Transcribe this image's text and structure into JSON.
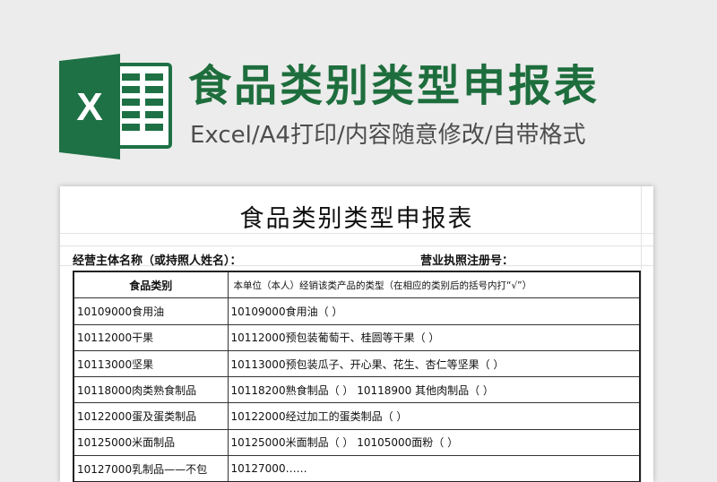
{
  "banner": {
    "title": "食品类别类型申报表",
    "subtitle": "Excel/A4打印/内容随意修改/自带格式",
    "logo_letter": "X",
    "logo_icon": "excel-logo-icon",
    "accent_color": "#1e6e3d"
  },
  "sheet": {
    "title": "食品类别类型申报表",
    "operator_label": "经营主体名称（或持照人姓名）：",
    "license_label": "营业执照注册号：",
    "table": {
      "headers": [
        "食品类别",
        "本单位（本人）经销该类产品的类型（在相应的类别后的括号内打“√”）"
      ],
      "rows": [
        [
          "10109000食用油",
          "10109000食用油（    ）"
        ],
        [
          "10112000干果",
          "10112000预包装葡萄干、桂圆等干果（    ）"
        ],
        [
          "10113000坚果",
          "10113000预包装瓜子、开心果、花生、杏仁等坚果（    ）"
        ],
        [
          "10118000肉类熟食制品",
          "10118200熟食制品（    ）   10118900  其他肉制品（    ）"
        ],
        [
          "10122000蛋及蛋类制品",
          "10122000经过加工的蛋类制品（    ）"
        ],
        [
          "10125000米面制品",
          "10125000米面制品（    ）   10105000面粉（    ）"
        ],
        [
          "10127000乳制品——不包",
          "10127000……"
        ]
      ]
    }
  }
}
